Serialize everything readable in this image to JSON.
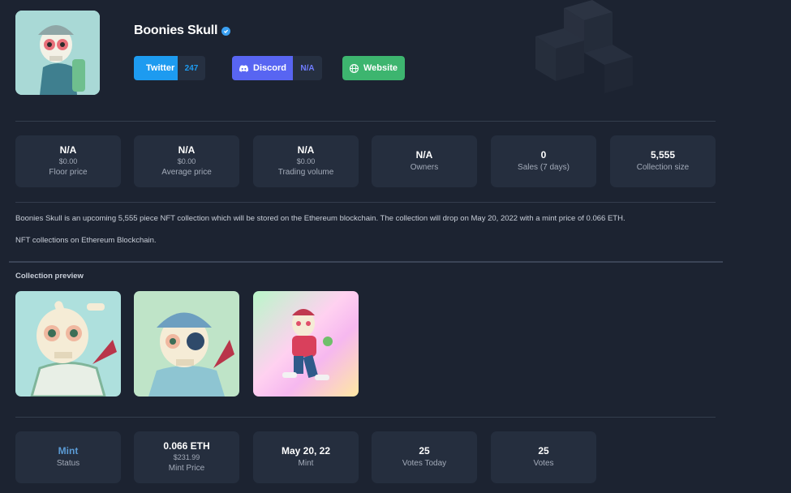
{
  "collection": {
    "name": "Boonies Skull",
    "verified_icon": "verified-badge-icon"
  },
  "social": {
    "twitter": {
      "label": "Twitter",
      "count": "247",
      "icon": "twitter-icon",
      "color": "#1d9bf0"
    },
    "discord": {
      "label": "Discord",
      "count": "N/A",
      "icon": "discord-icon",
      "color": "#5865f2"
    },
    "website": {
      "label": "Website",
      "icon": "globe-icon",
      "color": "#3db56f"
    }
  },
  "stats": [
    {
      "value": "N/A",
      "sub": "$0.00",
      "label": "Floor price"
    },
    {
      "value": "N/A",
      "sub": "$0.00",
      "label": "Average price"
    },
    {
      "value": "N/A",
      "sub": "$0.00",
      "label": "Trading volume"
    },
    {
      "value": "N/A",
      "label": "Owners"
    },
    {
      "value": "0",
      "label": "Sales (7 days)"
    },
    {
      "value": "5,555",
      "label": "Collection size"
    }
  ],
  "description": {
    "line1": "Boonies Skull is an upcoming 5,555 piece NFT collection which will be stored on the Ethereum blockchain. The collection will drop on May 20, 2022 with a mint price of 0.066 ETH.",
    "line2": "NFT collections on Ethereum Blockchain."
  },
  "preview": {
    "title": "Collection preview"
  },
  "details": [
    {
      "value": "Mint",
      "label": "Status"
    },
    {
      "value": "0.066 ETH",
      "sub": "$231.99",
      "label": "Mint Price"
    },
    {
      "value": "May 20, 22",
      "label": "Mint"
    },
    {
      "value": "25",
      "label": "Votes Today"
    },
    {
      "value": "25",
      "label": "Votes"
    }
  ],
  "colors": {
    "background": "#1c2331",
    "card": "#252e3e",
    "status_accent": "#5b9bd5"
  }
}
